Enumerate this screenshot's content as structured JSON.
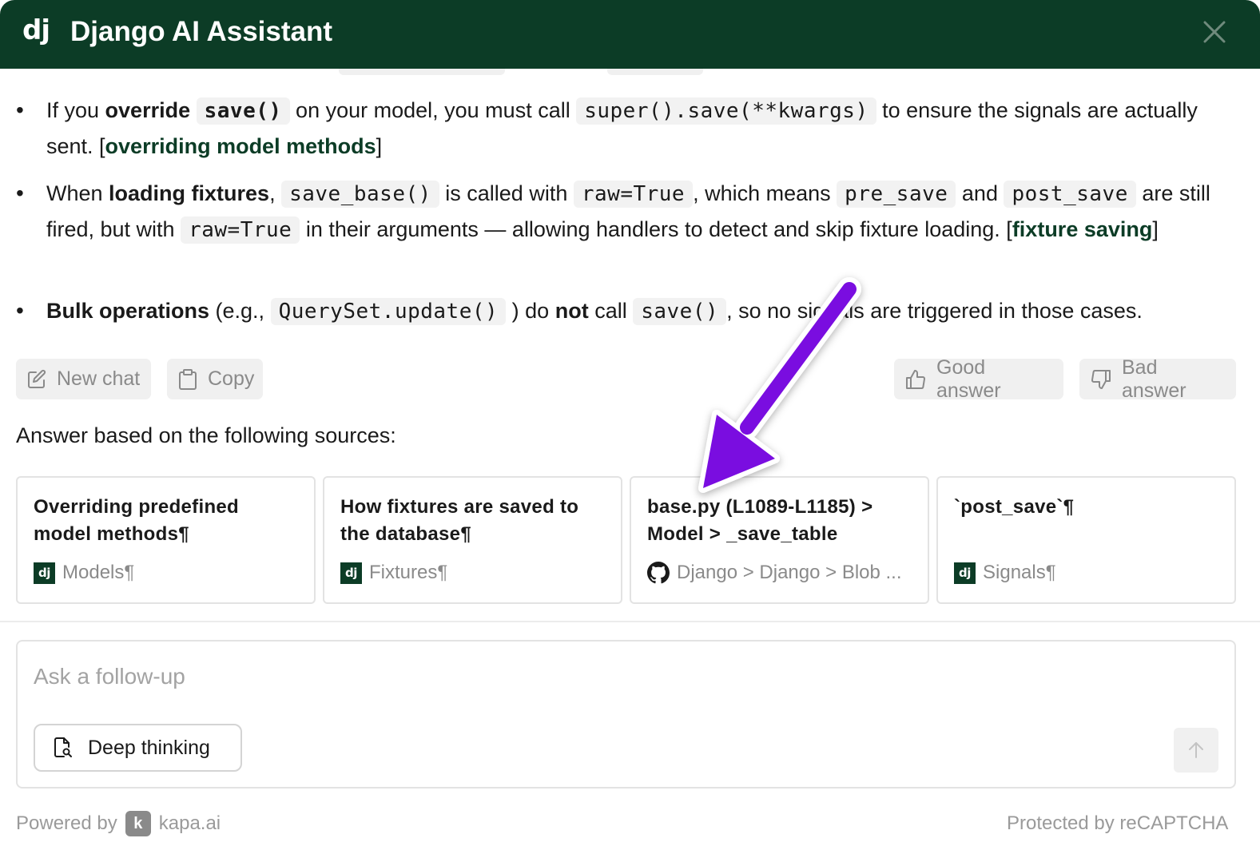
{
  "header": {
    "logo": "dj",
    "title": "Django AI Assistant"
  },
  "bullets": [
    {
      "parts": [
        {
          "t": "If you "
        },
        {
          "t": "override",
          "s": "b"
        },
        {
          "t": " "
        },
        {
          "t": "save()",
          "s": "code-b"
        },
        {
          "t": " on your model, you must call "
        },
        {
          "t": "super().save(**kwargs)",
          "s": "code"
        },
        {
          "t": " to ensure the signals are actually sent. ["
        },
        {
          "t": "overriding model methods",
          "s": "ref"
        },
        {
          "t": "]"
        }
      ]
    },
    {
      "parts": [
        {
          "t": "When "
        },
        {
          "t": "loading fixtures",
          "s": "b"
        },
        {
          "t": ", "
        },
        {
          "t": "save_base()",
          "s": "code"
        },
        {
          "t": " is called with "
        },
        {
          "t": "raw=True",
          "s": "code"
        },
        {
          "t": ", which means "
        },
        {
          "t": "pre_save",
          "s": "code"
        },
        {
          "t": " and "
        },
        {
          "t": "post_save",
          "s": "code"
        },
        {
          "t": " are still fired, but with "
        },
        {
          "t": "raw=True",
          "s": "code"
        },
        {
          "t": " in their arguments — allowing handlers to detect and skip fixture loading. ["
        },
        {
          "t": "fixture saving",
          "s": "ref"
        },
        {
          "t": "]"
        }
      ]
    },
    {
      "parts": [
        {
          "t": "Bulk operations",
          "s": "b"
        },
        {
          "t": " (e.g., "
        },
        {
          "t": "QuerySet.update()",
          "s": "code"
        },
        {
          "t": " ) do "
        },
        {
          "t": "not",
          "s": "b"
        },
        {
          "t": " call "
        },
        {
          "t": "save()",
          "s": "code"
        },
        {
          "t": ", so no signals are triggered in those cases."
        }
      ]
    }
  ],
  "actions": {
    "new_chat": "New chat",
    "copy": "Copy",
    "good_answer": "Good answer",
    "bad_answer": "Bad answer"
  },
  "sources_label": "Answer based on the following sources:",
  "sources": [
    {
      "title": "Overriding predefined model methods¶",
      "source": "Models¶",
      "icon": "django"
    },
    {
      "title": "How fixtures are saved to the database¶",
      "source": "Fixtures¶",
      "icon": "django"
    },
    {
      "title": "base.py (L1089-L1185) > Model > _save_table",
      "source": "Django > Django > Blob ...",
      "icon": "github"
    },
    {
      "title": "`post_save`¶",
      "source": "Signals¶",
      "icon": "django"
    }
  ],
  "input": {
    "placeholder": "Ask a follow-up",
    "deep_thinking": "Deep thinking"
  },
  "footer": {
    "powered_by": "Powered by",
    "brand_letter": "k",
    "brand": "kapa.ai",
    "recaptcha": "Protected by reCAPTCHA"
  },
  "colors": {
    "header_bg": "#0c3c26",
    "arrow": "#7a0ee0"
  }
}
